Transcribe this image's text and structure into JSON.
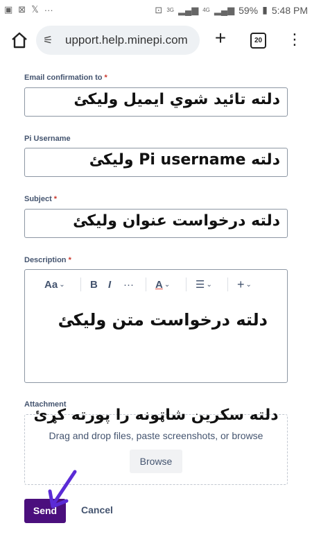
{
  "status_bar": {
    "left_icons": [
      "image-icon",
      "bluetooth-alt-icon",
      "x-icon"
    ],
    "dots": "···",
    "network": "3G",
    "network2": "4G",
    "battery": "59%",
    "time": "5:48 PM"
  },
  "browser": {
    "url": "upport.help.minepi.com",
    "tab_count": "20"
  },
  "form": {
    "email": {
      "label": "Email confirmation to",
      "required": "*",
      "value": "دلته تائيد شوي ايميل وليکئ"
    },
    "username": {
      "label": "Pi Username",
      "value": "دلته Pi username وليکئ"
    },
    "subject": {
      "label": "Subject",
      "required": "*",
      "value": "دلته درخواست عنوان وليکئ"
    },
    "description": {
      "label": "Description",
      "required": "*",
      "value": "دلته درخواست متن وليکئ",
      "toolbar": {
        "text_style": "Aa",
        "bold": "B",
        "italic": "I",
        "more": "···",
        "color": "A",
        "list": "☰",
        "insert": "+"
      }
    },
    "attachment": {
      "label": "Attachment",
      "drop_text": "Drag and drop files, paste screenshots, or browse",
      "browse": "Browse",
      "overlay": "دلته سکرين شاټونه را پورته کړئ"
    },
    "send": "Send",
    "cancel": "Cancel"
  },
  "colors": {
    "send_bg": "#4b0f7d",
    "arrow": "#5b2bd6"
  }
}
